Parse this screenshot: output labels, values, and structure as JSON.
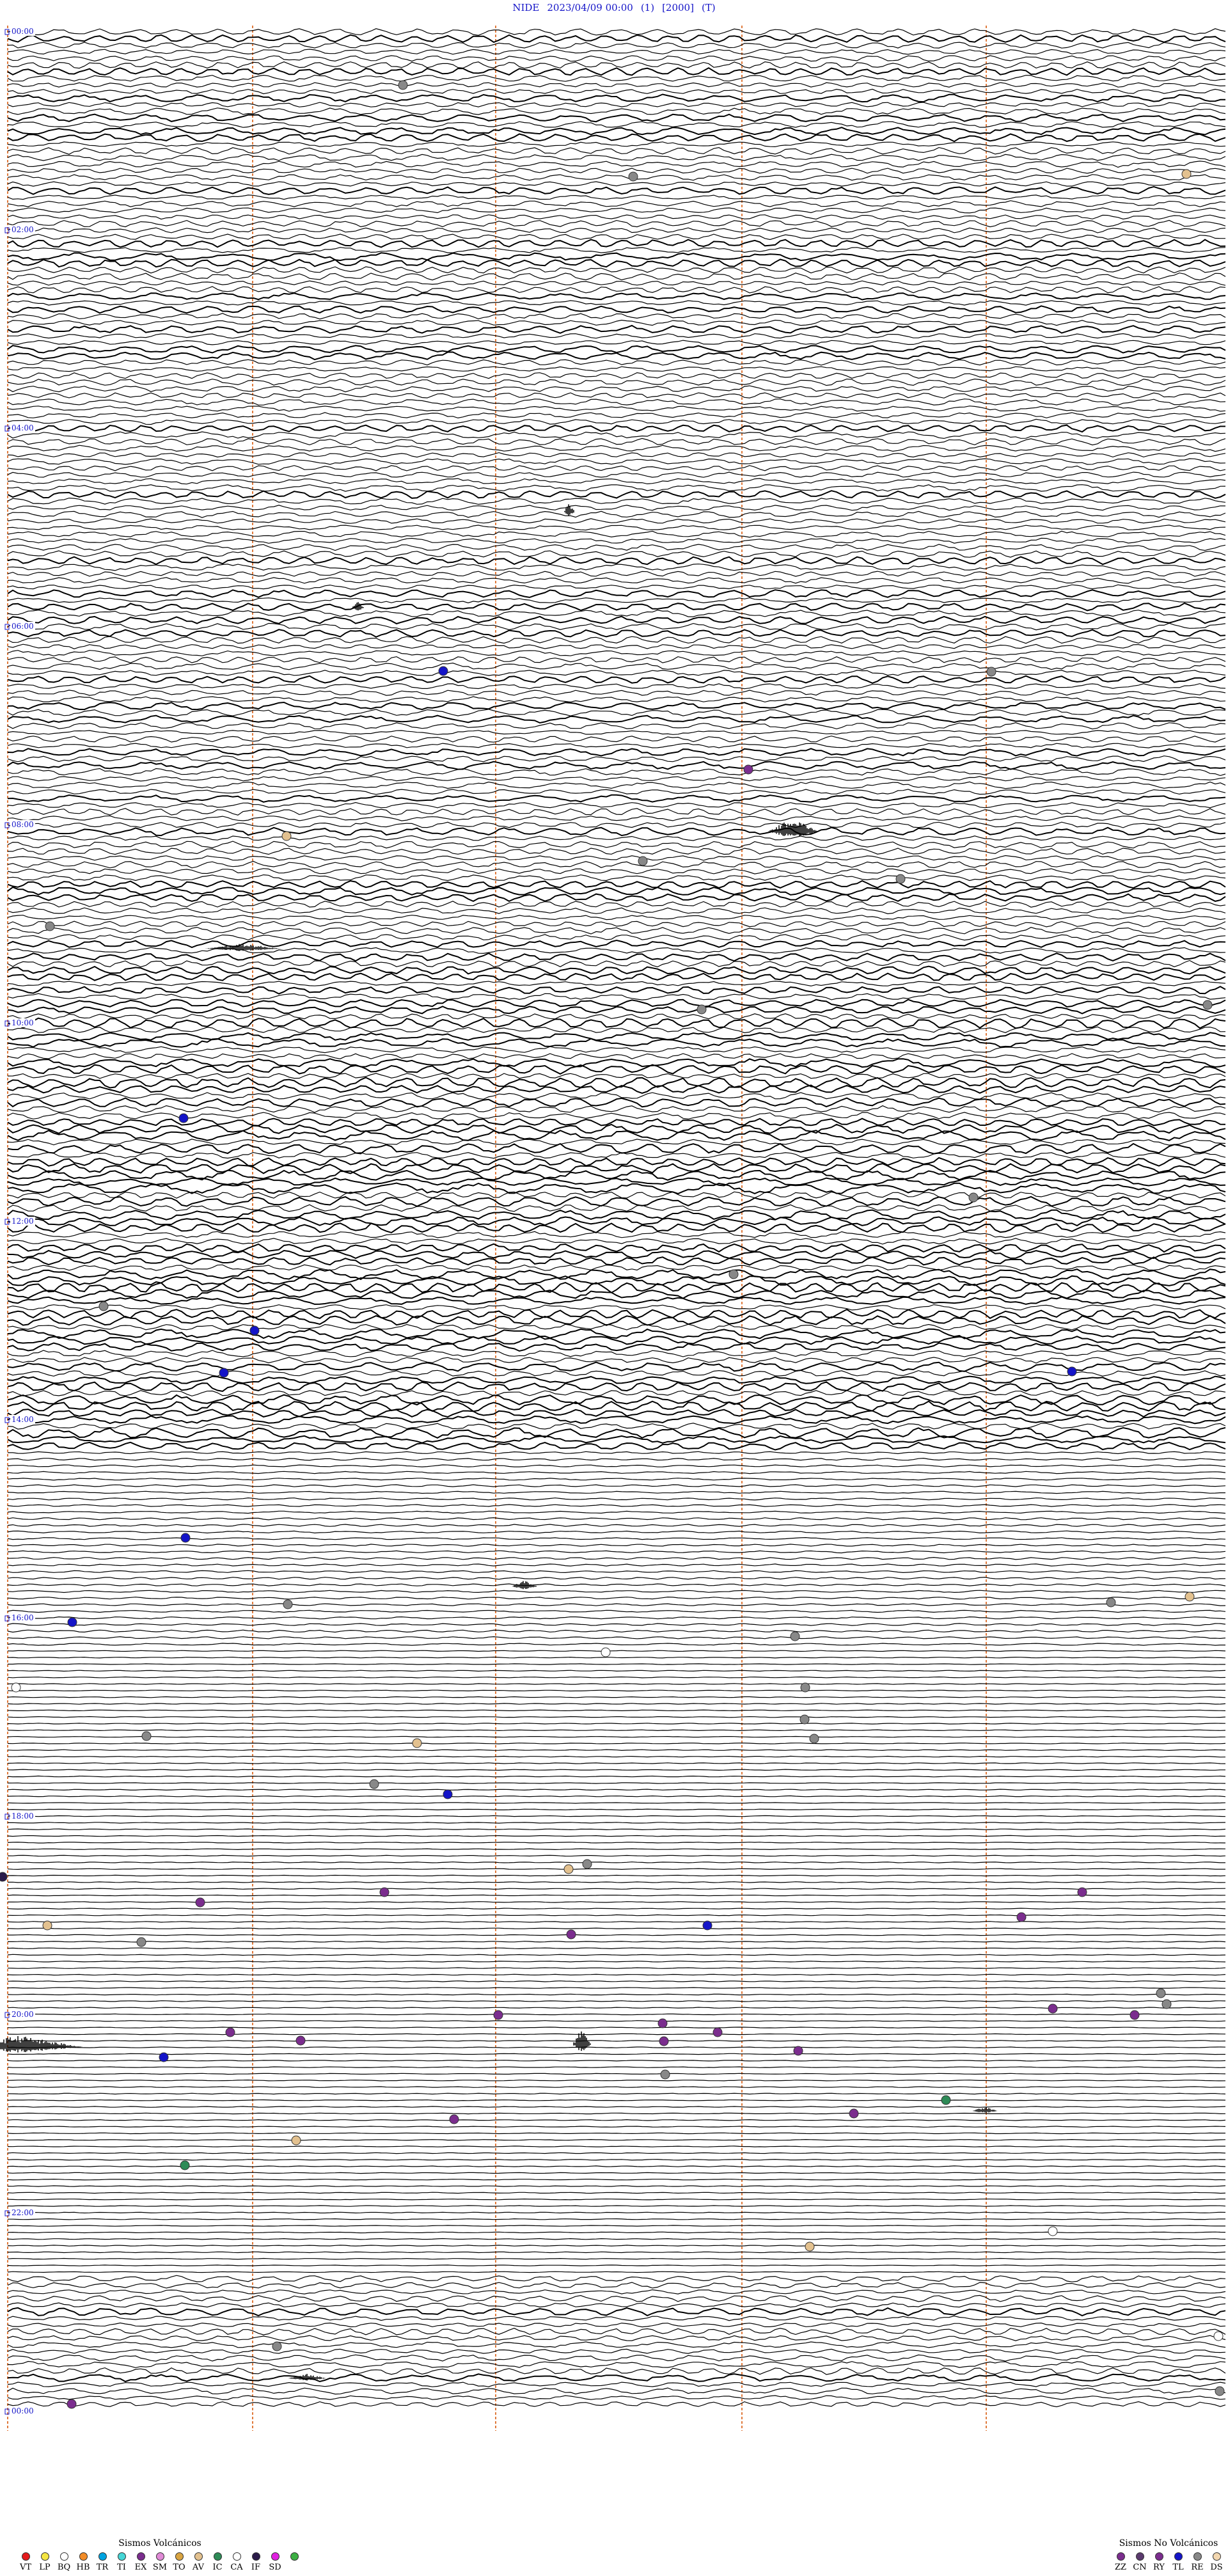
{
  "header": {
    "station": "NIDE",
    "datetime": "2023/04/09 00:00",
    "channel": "(1)",
    "scale": "[2000]",
    "component": "(T)"
  },
  "helicorder": {
    "hour_labels": [
      "00:00",
      "02:00",
      "04:00",
      "06:00",
      "08:00",
      "10:00",
      "12:00",
      "14:00",
      "16:00",
      "18:00",
      "20:00",
      "22:00",
      "00:00"
    ],
    "vertical_marker_color": "#e07a3c",
    "trace_color": "#000000",
    "label_color": "#1414c8"
  },
  "legend_volcanic": {
    "title": "Sismos Volcánicos",
    "items": [
      {
        "code": "VT",
        "color": "#e41a1c"
      },
      {
        "code": "LP",
        "color": "#f5e642"
      },
      {
        "code": "BQ",
        "color": "#ffffff"
      },
      {
        "code": "HB",
        "color": "#f28c28"
      },
      {
        "code": "TR",
        "color": "#00a3e0"
      },
      {
        "code": "TI",
        "color": "#46d6d6"
      },
      {
        "code": "EX",
        "color": "#7b2d8e"
      },
      {
        "code": "SM",
        "color": "#e08ad6"
      },
      {
        "code": "TO",
        "color": "#d9a441"
      },
      {
        "code": "AV",
        "color": "#e3c18f"
      },
      {
        "code": "IC",
        "color": "#2e8b57"
      },
      {
        "code": "CA",
        "color": "#ffffff"
      },
      {
        "code": "IF",
        "color": "#2b1b4a"
      },
      {
        "code": "SD",
        "color": "#e020e0"
      },
      {
        "code": "",
        "color": "#3cb043"
      }
    ]
  },
  "legend_non_volcanic": {
    "title": "Sismos No Volcánicos",
    "items": [
      {
        "code": "ZZ",
        "color": "#7b2d8e"
      },
      {
        "code": "CN",
        "color": "#5b3a6e"
      },
      {
        "code": "RY",
        "color": "#7b2d8e"
      },
      {
        "code": "TL",
        "color": "#1414c8"
      },
      {
        "code": "RE",
        "color": "#888888"
      },
      {
        "code": "DS",
        "color": "#f3d7b0"
      }
    ]
  }
}
